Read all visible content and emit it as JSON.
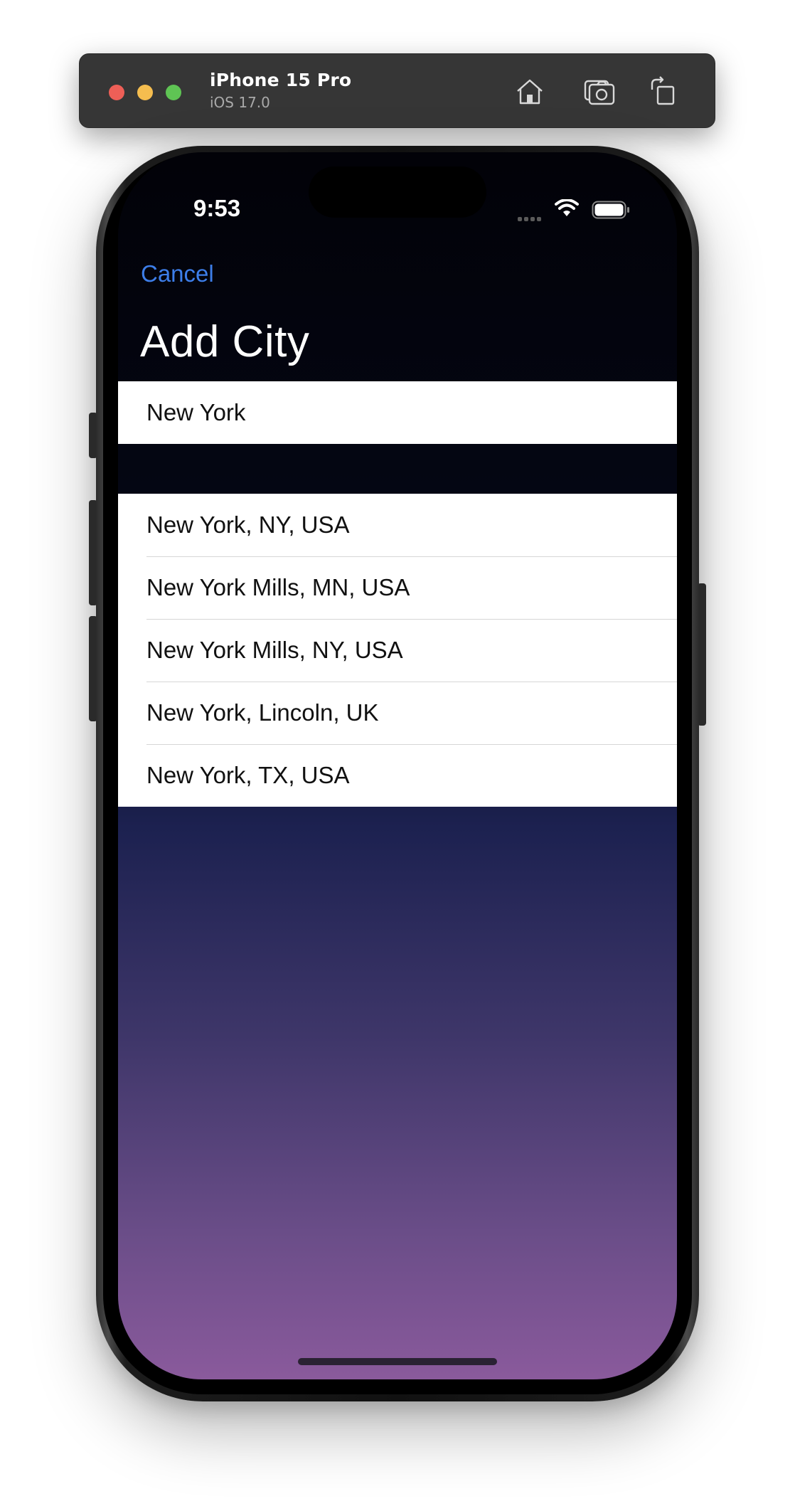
{
  "simulator": {
    "device_name": "iPhone 15 Pro",
    "os_version": "iOS 17.0",
    "traffic_lights": {
      "close_color": "#ee5f57",
      "minimize_color": "#f5bd4f",
      "zoom_color": "#5fc454"
    },
    "toolbar_icons": [
      "home-icon",
      "screenshot-icon",
      "rotate-icon"
    ]
  },
  "status_bar": {
    "time": "9:53"
  },
  "nav": {
    "cancel_label": "Cancel",
    "title": "Add City"
  },
  "search": {
    "value": "New York"
  },
  "results": [
    "New York, NY, USA",
    "New York Mills, MN, USA",
    "New York Mills, NY, USA",
    "New York, Lincoln, UK",
    "New York, TX, USA"
  ],
  "colors": {
    "accent": "#3d7ee9"
  }
}
